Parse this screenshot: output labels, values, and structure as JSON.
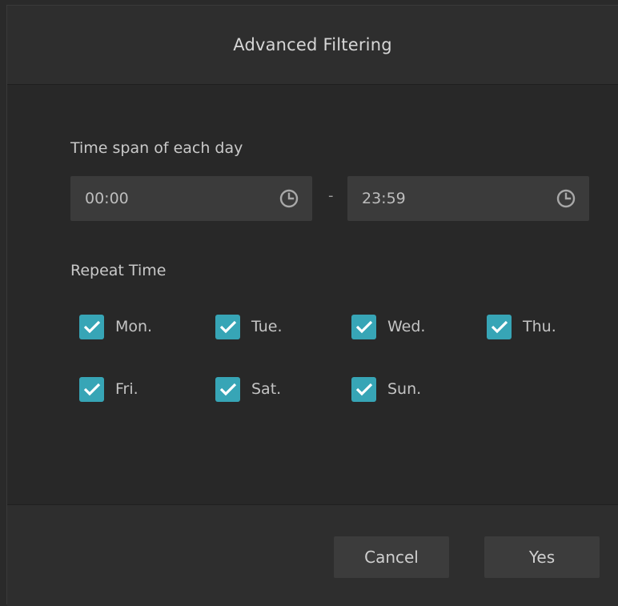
{
  "dialog": {
    "title": "Advanced Filtering"
  },
  "time_span": {
    "label": "Time span of each day",
    "start": "00:00",
    "separator": "-",
    "end": "23:59",
    "icon": "clock-icon"
  },
  "repeat": {
    "label": "Repeat Time",
    "days": [
      {
        "label": "Mon.",
        "checked": true
      },
      {
        "label": "Tue.",
        "checked": true
      },
      {
        "label": "Wed.",
        "checked": true
      },
      {
        "label": "Thu.",
        "checked": true
      },
      {
        "label": "Fri.",
        "checked": true
      },
      {
        "label": "Sat.",
        "checked": true
      },
      {
        "label": "Sun.",
        "checked": true
      }
    ]
  },
  "buttons": {
    "cancel": "Cancel",
    "yes": "Yes"
  },
  "colors": {
    "accent": "#37a5b6",
    "background": "#282828"
  }
}
